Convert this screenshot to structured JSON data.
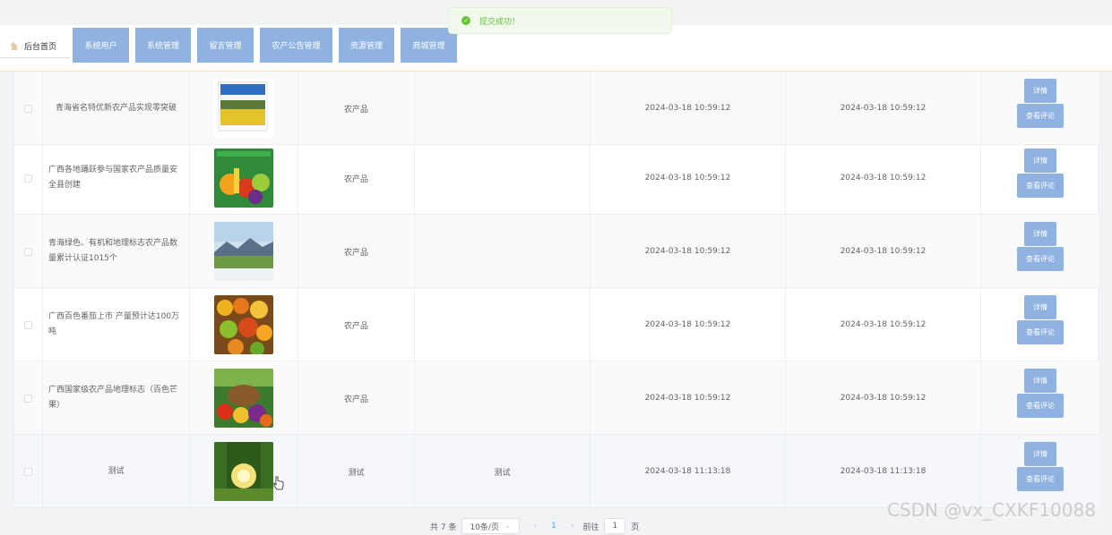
{
  "toast": {
    "message": "提交成功！"
  },
  "nav": {
    "home_label": "后台首页",
    "tabs": [
      "系统用户",
      "系统管理",
      "留言管理",
      "农产公告管理",
      "资源管理",
      "商城管理"
    ]
  },
  "table": {
    "rows": [
      {
        "title": "青海省名特优新农产品实现零突破",
        "category": "农产品",
        "content": "",
        "created": "2024-03-18 10:59:12",
        "updated": "2024-03-18 10:59:12",
        "image": "grassland-sky"
      },
      {
        "title": "广西各地踊跃参与国家农产品质量安全县创建",
        "category": "农产品",
        "content": "",
        "created": "2024-03-18 10:59:12",
        "updated": "2024-03-18 10:59:12",
        "image": "vegetables"
      },
      {
        "title": "青海绿色、有机和地理标志农产品数量累计认证1015个",
        "category": "农产品",
        "content": "",
        "created": "2024-03-18 10:59:12",
        "updated": "2024-03-18 10:59:12",
        "image": "mountain-poster"
      },
      {
        "title": "广西百色番茄上市 产量预计达100万吨",
        "category": "农产品",
        "content": "",
        "created": "2024-03-18 10:59:12",
        "updated": "2024-03-18 10:59:12",
        "image": "fruit-stall"
      },
      {
        "title": "广西国家级农产品地理标志（百色芒果）",
        "category": "农产品",
        "content": "",
        "created": "2024-03-18 10:59:12",
        "updated": "2024-03-18 10:59:12",
        "image": "vegetable-basket"
      },
      {
        "title": "测试",
        "category": "测试",
        "content": "测试",
        "created": "2024-03-18 11:13:18",
        "updated": "2024-03-18 11:13:18",
        "image": "sunlight-forest"
      }
    ],
    "detail_label": "详情",
    "comment_label": "查看评论"
  },
  "pagination": {
    "total": "共 7 条",
    "page_size": "10条/页",
    "current_page": "1",
    "goto_label": "前往",
    "goto_value": "1",
    "page_suffix": "页"
  },
  "watermark": "CSDN @vx_CXKF10088",
  "colors": {
    "tab_bg": "#8fb2e0",
    "toast_text": "#67c23a",
    "accent": "#409eff"
  }
}
